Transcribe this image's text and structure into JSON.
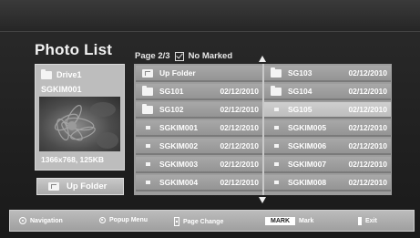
{
  "header": {
    "title": "Photo List",
    "page_label": "Page 2/3",
    "marked_label": "No Marked"
  },
  "preview": {
    "drive_label": "Drive1",
    "file_name": "SGKIM001",
    "dimensions": "1366x768, 125KB",
    "up_button_label": "Up Folder"
  },
  "list": {
    "left": [
      {
        "icon": "up-folder-icon",
        "name": "Up Folder",
        "date": ""
      },
      {
        "icon": "folder-icon",
        "name": "SG101",
        "date": "02/12/2010"
      },
      {
        "icon": "folder-icon",
        "name": "SG102",
        "date": "02/12/2010"
      },
      {
        "icon": "file-icon",
        "name": "SGKIM001",
        "date": "02/12/2010"
      },
      {
        "icon": "file-icon",
        "name": "SGKIM002",
        "date": "02/12/2010"
      },
      {
        "icon": "file-icon",
        "name": "SGKIM003",
        "date": "02/12/2010"
      },
      {
        "icon": "file-icon",
        "name": "SGKIM004",
        "date": "02/12/2010"
      }
    ],
    "right": [
      {
        "icon": "folder-icon",
        "name": "SG103",
        "date": "02/12/2010"
      },
      {
        "icon": "folder-icon",
        "name": "SG104",
        "date": "02/12/2010"
      },
      {
        "icon": "file-icon",
        "name": "SG105",
        "date": "02/12/2010",
        "selected": true
      },
      {
        "icon": "file-icon",
        "name": "SGKIM005",
        "date": "02/12/2010"
      },
      {
        "icon": "file-icon",
        "name": "SGKIM006",
        "date": "02/12/2010"
      },
      {
        "icon": "file-icon",
        "name": "SGKIM007",
        "date": "02/12/2010"
      },
      {
        "icon": "file-icon",
        "name": "SGKIM008",
        "date": "02/12/2010"
      }
    ]
  },
  "footer": {
    "navigation": "Navigation",
    "popup_menu": "Popup Menu",
    "page_change": "Page Change",
    "mark_key": "MARK",
    "mark": "Mark",
    "exit": "Exit"
  }
}
